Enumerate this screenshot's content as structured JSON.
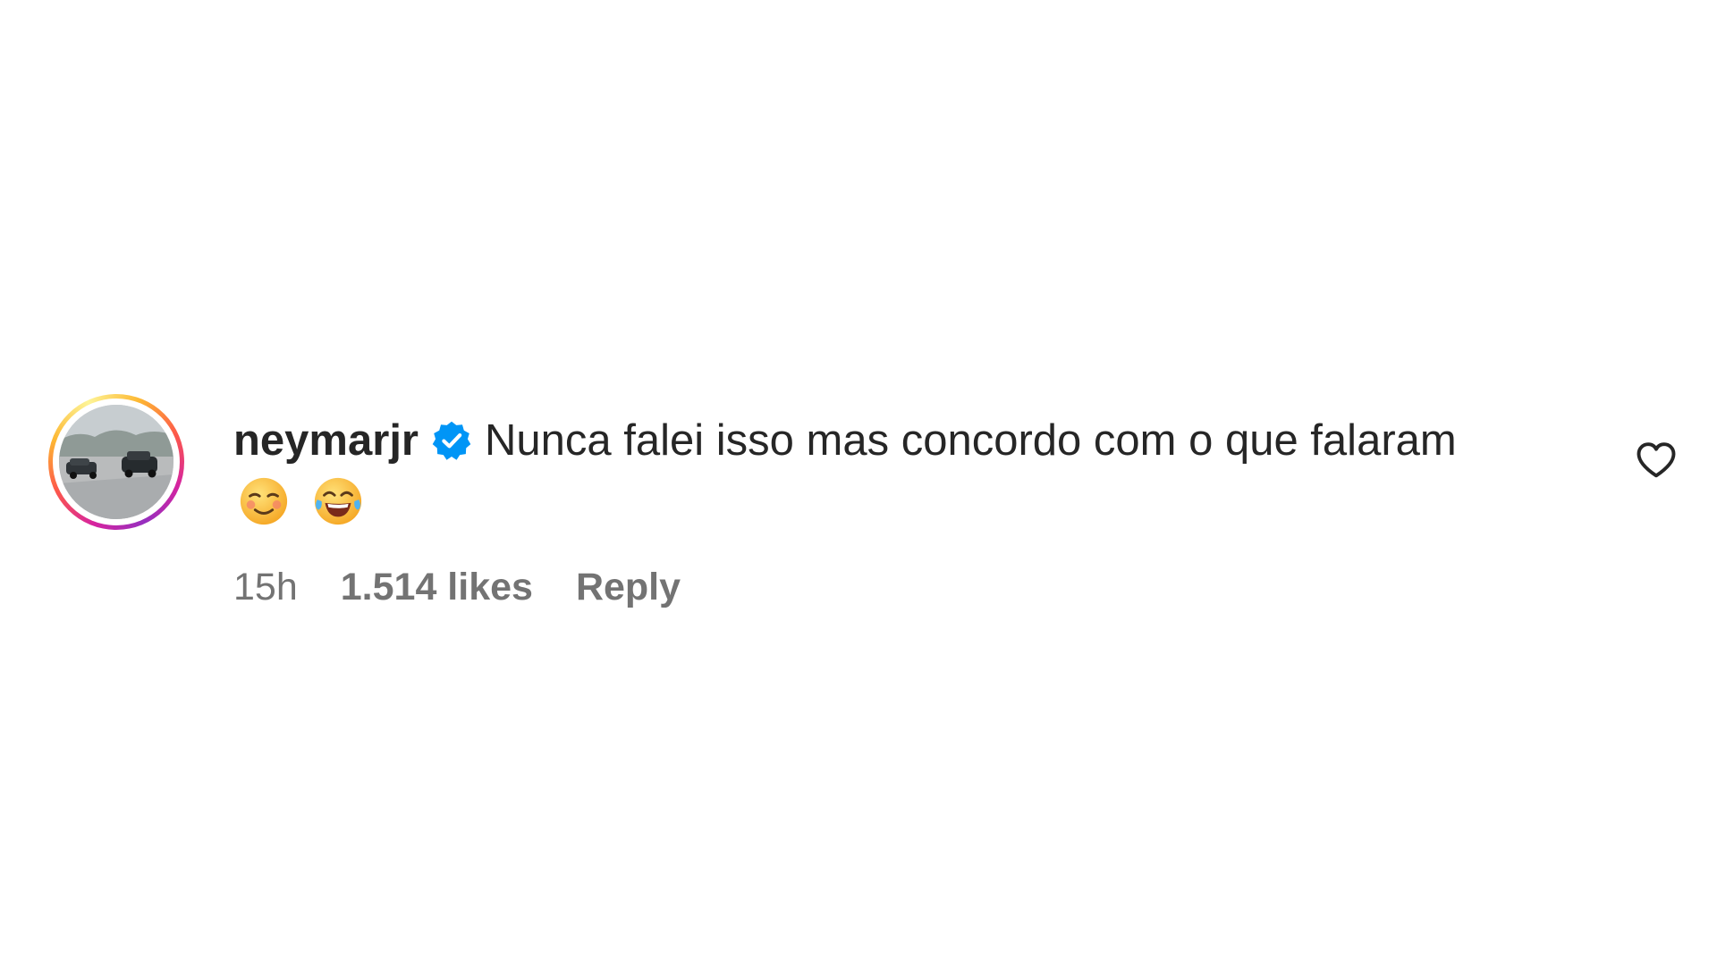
{
  "comment": {
    "username": "neymarjr",
    "verified": true,
    "text": "Nunca falei isso mas concordo com o que falaram",
    "emojis": [
      "😌",
      "😂"
    ],
    "time": "15h",
    "likes": "1.514 likes",
    "reply_label": "Reply"
  },
  "colors": {
    "text": "#262626",
    "meta": "#737373",
    "verified_badge": "#0095f6"
  },
  "icons": {
    "verified": "verified-badge-icon",
    "like": "heart-outline-icon"
  }
}
